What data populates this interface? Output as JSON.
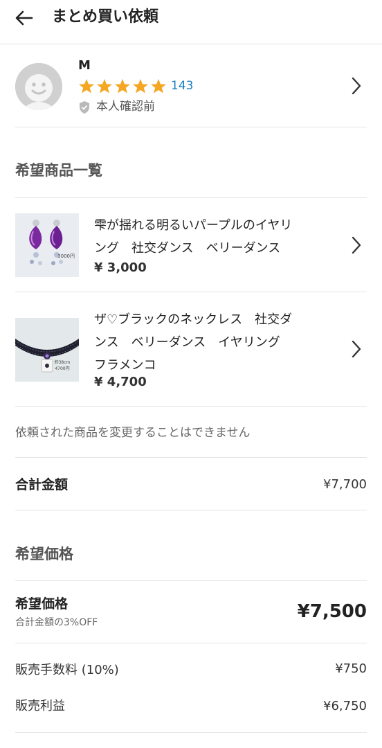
{
  "header": {
    "title": "まとめ買い依頼",
    "back_icon": "arrow-left-icon"
  },
  "seller": {
    "name": "M",
    "rating_stars": 5,
    "rating_count": "143",
    "verification": "本人確認前",
    "star_color": "#f5a623"
  },
  "items_section": {
    "heading": "希望商品一覧",
    "items": [
      {
        "title": "雫が揺れる明るいパープルのイヤリング　社交ダンス　ベリーダンス",
        "title_lines": [
          "雫が揺れる明るいパープルのイヤリ",
          "ング　社交ダンス　ベリーダンス"
        ],
        "price": "¥ 3,000",
        "thumb_caption": "3000円"
      },
      {
        "title": "ザ♡ブラックのネックレス　社交ダンス　ベリーダンス　イヤリング　フラメンコ",
        "title_lines": [
          "ザ♡ブラックのネックレス　社交ダ",
          "ンス　ベリーダンス　イヤリング",
          "フラメンコ"
        ],
        "price": "¥ 4,700",
        "thumb_caption_1": "約38cm",
        "thumb_caption_2": "4700円"
      }
    ],
    "note": "依頼された商品を変更することはできません"
  },
  "summary": {
    "total_label": "合計金額",
    "total_value": "¥7,700"
  },
  "desired_section": {
    "heading": "希望価格",
    "label": "希望価格",
    "sub": "合計金額の3%OFF",
    "value": "¥7,500",
    "fee_label": "販売手数料 (10%)",
    "fee_value": "¥750",
    "profit_label": "販売利益",
    "profit_value": "¥6,750"
  }
}
